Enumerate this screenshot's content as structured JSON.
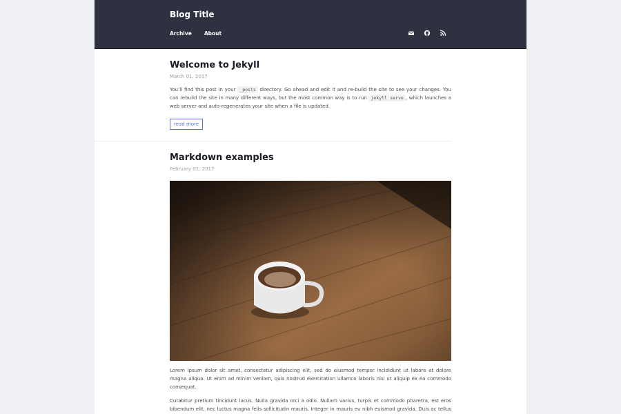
{
  "header": {
    "blog_title": "Blog Title",
    "nav": [
      "Archive",
      "About"
    ],
    "social_icons": [
      "envelope-icon",
      "github-icon",
      "rss-icon"
    ],
    "bg_color": "#2e3140"
  },
  "posts": [
    {
      "title": "Welcome to Jekyll",
      "date": "March 01, 2017",
      "excerpt_parts": [
        "You’ll find this post in your ",
        "_posts",
        " directory. Go ahead and edit it and re-build the site to see your changes. You can rebuild the site in many different ways, but the most common way is to run ",
        "jekyll serve",
        ", which launches a web server and auto-regenerates your site when a file is updated."
      ],
      "read_more": "read more"
    },
    {
      "title": "Markdown examples",
      "date": "February 01, 2017",
      "paragraphs": [
        "Lorem ipsum dolor sit amet, consectetur adipiscing elit, sed do eiusmod tempor incididunt ut labore et dolore magna aliqua. Ut enim ad minim veniam, quis nostrud exercitation ullamco laboris nisi ut aliquip ex ea commodo consequat.",
        "Curabitur pretium tincidunt lacus. Nulla gravida orci a odio. Nullam varius, turpis et commodo pharetra, est eros bibendum elit, nec luctus magna felis sollicitudin mauris. Integer in mauris eu nibh euismod gravida. Duis ac tellus et risus vulputate vehicula. Donec lobortis risus a elit."
      ]
    }
  ],
  "colors": {
    "link_accent": "#5a6fd6",
    "page_bg": "#eef0f4"
  }
}
